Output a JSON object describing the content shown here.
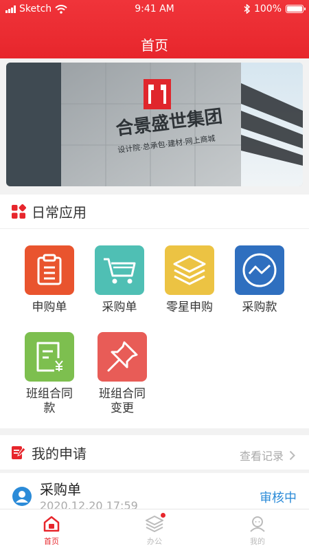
{
  "status_bar": {
    "carrier": "Sketch",
    "time": "9:41 AM",
    "battery": "100%"
  },
  "header": {
    "title": "首页"
  },
  "banner": {
    "brand": "合景盛世集团",
    "tagline": "设计院·总承包·建材·网上商城"
  },
  "daily_apps": {
    "title": "日常应用",
    "items": [
      {
        "label": "申购单",
        "color": "#e9542e"
      },
      {
        "label": "采购单",
        "color": "#4fbfb4"
      },
      {
        "label": "零星申购",
        "color": "#ecc343"
      },
      {
        "label": "采购款",
        "color": "#2f6fbf"
      },
      {
        "label": "班组合同款",
        "color": "#7dbf4f"
      },
      {
        "label": "班组合同变更",
        "color": "#e85c57"
      }
    ]
  },
  "my_requests": {
    "title": "我的申请",
    "view_records": "查看记录",
    "items": [
      {
        "title": "采购单",
        "time": "2020.12.20 17:59",
        "status": "审核中"
      }
    ]
  },
  "tabbar": {
    "items": [
      {
        "label": "首页",
        "active": true
      },
      {
        "label": "办公",
        "active": false,
        "badge": true
      },
      {
        "label": "我的",
        "active": false
      }
    ]
  },
  "colors": {
    "primary": "#e7262c",
    "status_blue": "#2b8bd8"
  }
}
